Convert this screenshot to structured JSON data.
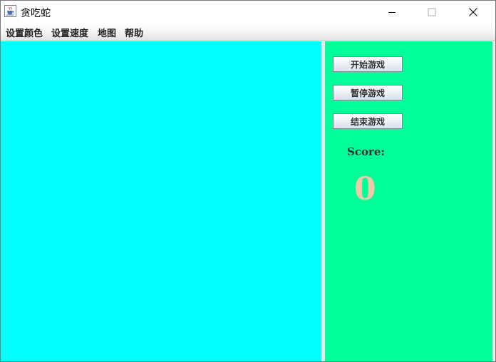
{
  "window": {
    "title": "贪吃蛇",
    "icon": "java-cup-icon"
  },
  "menu": {
    "items": [
      {
        "label": "设置颜色"
      },
      {
        "label": "设置速度"
      },
      {
        "label": "地图"
      },
      {
        "label": "帮助"
      }
    ]
  },
  "panel": {
    "start_label": "开始游戏",
    "pause_label": "暂停游戏",
    "end_label": "结束游戏",
    "score_label": "Score:",
    "score_value": "0"
  },
  "colors": {
    "game_area": "#00ffff",
    "side_panel": "#00ff99",
    "score_value": "#f2c9a8"
  }
}
